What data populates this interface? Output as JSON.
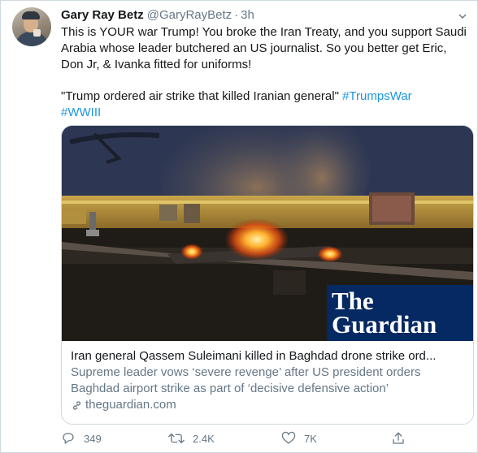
{
  "tweet": {
    "author_name": "Gary Ray Betz",
    "handle": "@GaryRayBetz",
    "separator": "·",
    "time": "3h",
    "text_line1": "This is YOUR war Trump! You broke the Iran Treaty, and you support Saudi Arabia whose leader butchered an US journalist. So you better get Eric, Don Jr, & Ivanka fitted for uniforms!",
    "quote_text": "\"Trump ordered air strike that killed Iranian general\" ",
    "hashtags": [
      "#TrumpsWar",
      "#WWIII"
    ]
  },
  "card": {
    "logo_line1": "The",
    "logo_line2": "Guardian",
    "title": "Iran general Qassem Suleimani killed in Baghdad drone strike ord...",
    "description": "Supreme leader vows ‘severe revenge’ after US president orders Baghdad airport strike as part of ‘decisive defensive action’",
    "domain": "theguardian.com"
  },
  "actions": {
    "reply_count": "349",
    "retweet_count": "2.4K",
    "like_count": "7K"
  },
  "icons": {
    "caret": "chevron-down-icon",
    "link": "link-icon",
    "reply": "reply-icon",
    "retweet": "retweet-icon",
    "like": "heart-icon",
    "share": "share-icon"
  },
  "colors": {
    "hashtag": "#1b95e0",
    "muted": "#657786",
    "guardian_blue": "#052962"
  }
}
